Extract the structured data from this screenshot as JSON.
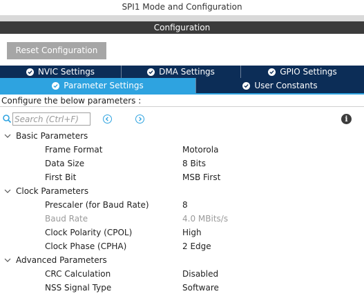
{
  "window": {
    "title": "SPI1 Mode and Configuration"
  },
  "config_header": "Configuration",
  "reset_button": "Reset Configuration",
  "tabs_row1": [
    {
      "label": "NVIC Settings"
    },
    {
      "label": "DMA Settings"
    },
    {
      "label": "GPIO Settings"
    }
  ],
  "tabs_row2": [
    {
      "label": "Parameter Settings",
      "active": true
    },
    {
      "label": "User Constants",
      "active": false
    }
  ],
  "configure_label": "Configure the below parameters :",
  "search": {
    "placeholder": "Search (Ctrl+F)"
  },
  "groups": [
    {
      "label": "Basic Parameters",
      "params": [
        {
          "name": "Frame Format",
          "value": "Motorola"
        },
        {
          "name": "Data Size",
          "value": "8 Bits"
        },
        {
          "name": "First Bit",
          "value": "MSB First"
        }
      ]
    },
    {
      "label": "Clock Parameters",
      "params": [
        {
          "name": "Prescaler (for Baud Rate)",
          "value": "8"
        },
        {
          "name": "Baud Rate",
          "value": "4.0 MBits/s",
          "disabled": true
        },
        {
          "name": "Clock Polarity (CPOL)",
          "value": "High"
        },
        {
          "name": "Clock Phase (CPHA)",
          "value": "2 Edge"
        }
      ]
    },
    {
      "label": "Advanced Parameters",
      "params": [
        {
          "name": "CRC Calculation",
          "value": "Disabled"
        },
        {
          "name": "NSS Signal Type",
          "value": "Software"
        }
      ]
    }
  ],
  "colors": {
    "tab_dark": "#0c2d57",
    "tab_active": "#2ea3e0",
    "header_bg": "#3b3b3b",
    "disabled_text": "#9a9a9a"
  }
}
